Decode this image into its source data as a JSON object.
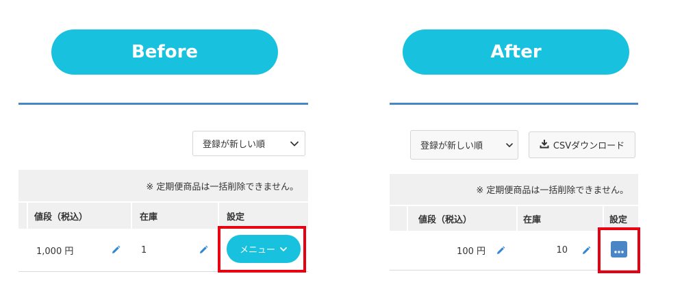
{
  "before": {
    "heading": "Before",
    "sort_select": {
      "value": "登録が新しい順"
    },
    "notice": "※ 定期便商品は一括削除できません。",
    "columns": {
      "price": "値段（税込）",
      "stock": "在庫",
      "settings": "設定"
    },
    "row": {
      "price": "1,000 円",
      "stock": "1"
    },
    "menu_button": "メニュー"
  },
  "after": {
    "heading": "After",
    "sort_select": {
      "value": "登録が新しい順"
    },
    "csv_button": "CSVダウンロード",
    "notice": "※ 定期便商品は一括削除できません。",
    "columns": {
      "price": "値段（税込）",
      "stock": "在庫",
      "settings": "設定"
    },
    "row": {
      "price": "100 円",
      "stock": "10"
    }
  },
  "colors": {
    "accent_cyan": "#18c2de",
    "accent_blue": "#4a86c5",
    "highlight_red": "#e60012",
    "table_header_bg": "#f0f0f0"
  },
  "icons": [
    "chevron-down-icon",
    "pencil-icon",
    "download-icon",
    "ellipsis-icon"
  ]
}
